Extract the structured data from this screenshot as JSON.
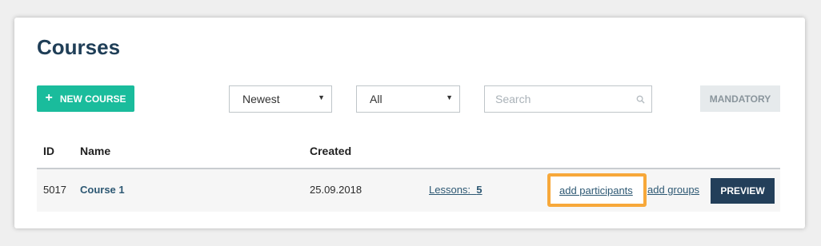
{
  "page": {
    "title": "Courses"
  },
  "toolbar": {
    "new_course_label": "NEW COURSE",
    "plus_glyph": "+",
    "sort_select": {
      "value": "Newest",
      "caret": "▼"
    },
    "filter_select": {
      "value": "All",
      "caret": "▼"
    },
    "search": {
      "placeholder": "Search",
      "value": ""
    },
    "mandatory_label": "MANDATORY"
  },
  "table": {
    "columns": {
      "id": "ID",
      "name": "Name",
      "created": "Created"
    },
    "rows": [
      {
        "id": "5017",
        "name": "Course 1",
        "created": "25.09.2018",
        "lessons_label": "Lessons:",
        "lessons_count": "5",
        "add_participants": "add participants",
        "add_groups": "add groups",
        "preview": "PREVIEW"
      }
    ]
  },
  "colors": {
    "accent_green": "#1abc9c",
    "title_navy": "#1f3e57",
    "preview_navy": "#233f5a",
    "highlight_orange": "#f7a83a",
    "mandatory_bg": "#e6eaec"
  },
  "icons": {
    "search": "search-icon",
    "plus": "plus-icon",
    "caret": "chevron-down-icon"
  }
}
